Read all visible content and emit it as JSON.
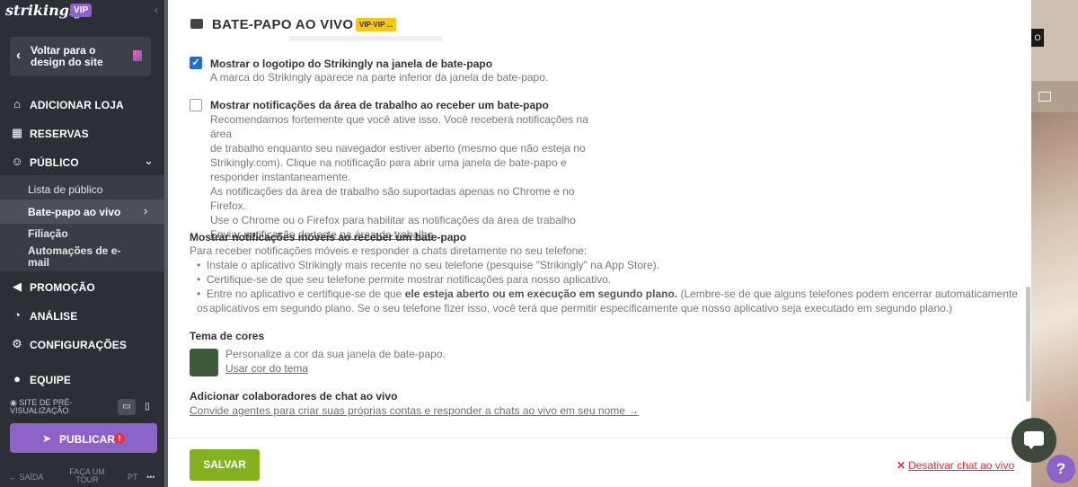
{
  "sidebar": {
    "brand": "strikingly",
    "vip": "VIP",
    "back": "Voltar para o design do site",
    "nav": {
      "loja": "ADICIONAR LOJA",
      "reservas": "RESERVAS",
      "publico": "PÚBLICO",
      "promocao": "PROMOÇÃO",
      "analise": "ANÁLISE",
      "config": "CONFIGURAÇÕES",
      "equipe": "EQUIPE"
    },
    "sub": {
      "lista": "Lista de público",
      "batepapo": "Bate-papo ao vivo",
      "filiacao": "Filiação",
      "automacoes": "Automações de e-mail"
    },
    "preview_label": "SITE DE PRÉ-VISUALIZAÇÃO",
    "publish": "PUBLICAR",
    "publish_alert": "!",
    "footer": {
      "exit": "SAÍDA",
      "tour": "FAÇA UM TOUR",
      "lang": "PT",
      "more": "•••"
    }
  },
  "panel": {
    "title": "BATE-PAPO AO VIVO",
    "badge": "VIP·VIP ...",
    "opt_logo": {
      "title": "Mostrar o logotipo do Strikingly na janela de bate-papo",
      "desc": "A marca do Strikingly aparece na parte inferior da janela de bate-papo.",
      "checked": true
    },
    "opt_desktop": {
      "title": "Mostrar notificações da área de trabalho ao receber um bate-papo",
      "lines": [
        "Recomendamos fortemente que você ative isso. Você receberá notificações na área",
        "de trabalho enquanto seu navegador estiver aberto (mesmo que não esteja no",
        "Strikingly.com). Clique na notificação para abrir uma janela de bate-papo e",
        "responder instantaneamente.",
        "As notificações da área de trabalho são suportadas apenas no Chrome e no Firefox.",
        "Use o Chrome ou o Firefox para habilitar as notificações da área de trabalho"
      ],
      "test_link": "Enviar notificação de teste na área de trabalho",
      "checked": false
    },
    "mobile": {
      "title": "Mostrar notificações móveis ao receber um bate-papo",
      "intro": "Para receber notificações móveis e responder a chats diretamente no seu telefone:",
      "b1": "Instale o aplicativo Strikingly mais recente no seu telefone (pesquise \"Strikingly\" na App Store).",
      "b2": "Certifique-se de que seu telefone permite mostrar notificações para nosso aplicativo.",
      "b3a": "Entre no aplicativo e certifique-se de que ",
      "b3b": "ele esteja aberto ou em execução em segundo plano.",
      "b3c": " (Lembre-se de que alguns telefones podem encerrar automaticamente os",
      "b3d": "aplicativos em segundo plano. Se o seu telefone fizer isso, você terá que permitir especificamente que nosso aplicativo seja executado em segundo plano.)"
    },
    "theme": {
      "title": "Tema de cores",
      "desc": "Personalize a cor da sua janela de bate-papo.",
      "link": "Usar cor do tema",
      "color": "#3d5a3b"
    },
    "collab": {
      "title": "Adicionar colaboradores de chat ao vivo",
      "link": "Convide agentes para criar suas próprias contas e responder a chats ao vivo em seu nome →"
    },
    "save": "SALVAR",
    "deactivate": "Desativar chat ao vivo"
  },
  "colors": {
    "accent": "#8e63c9",
    "save": "#84b21f",
    "danger": "#d6333f",
    "sidebar": "#2c2f36"
  },
  "icons": [
    "store-icon",
    "calendar-icon",
    "users-icon",
    "megaphone-icon",
    "chart-icon",
    "gear-icon",
    "team-icon",
    "chat-icon",
    "help-icon",
    "rocket-icon",
    "desktop-icon",
    "mobile-icon"
  ]
}
